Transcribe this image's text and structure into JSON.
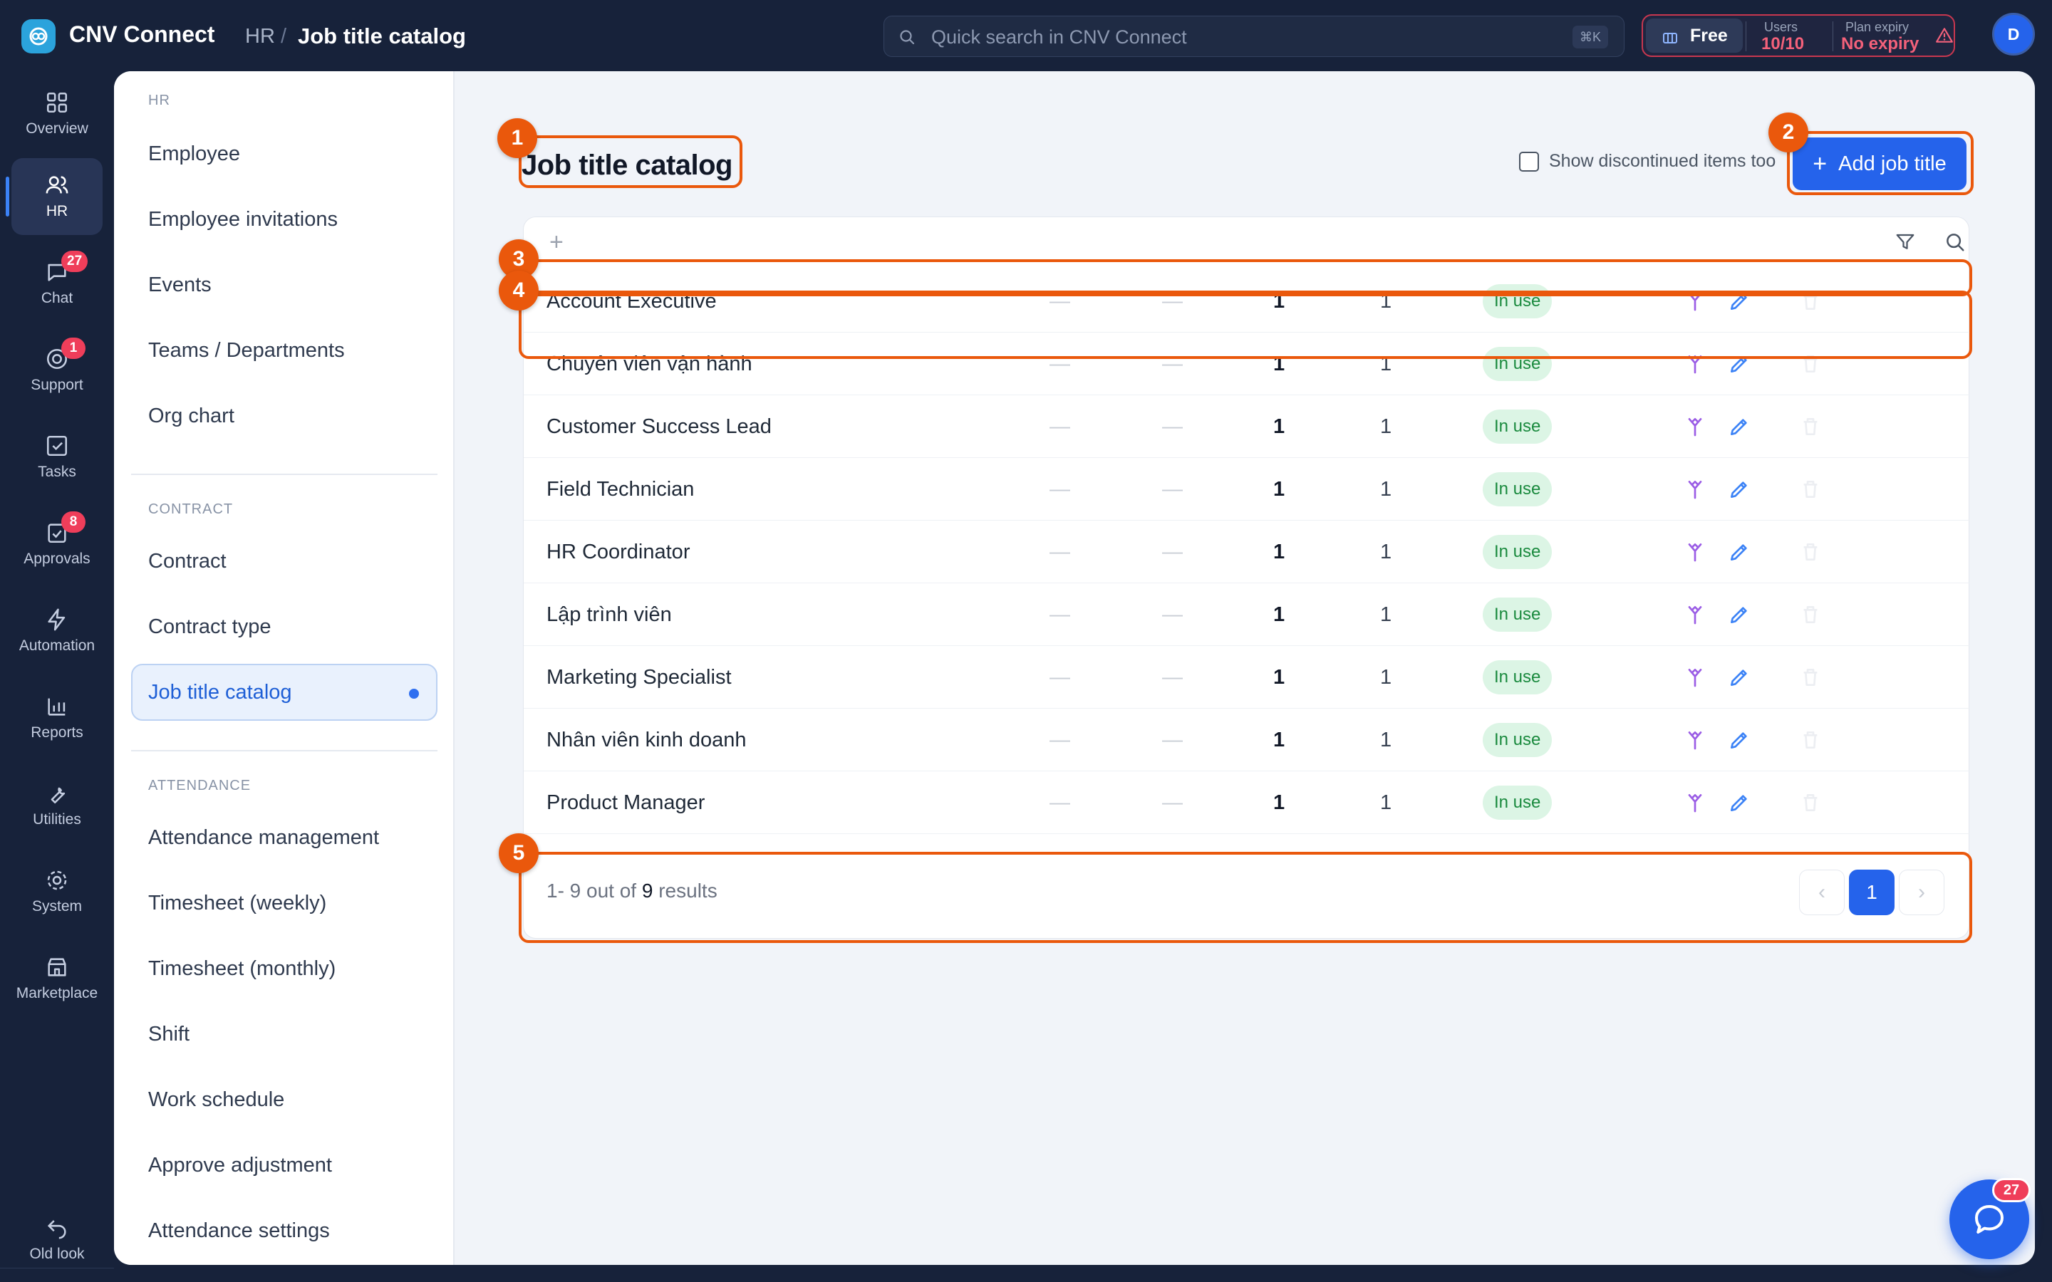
{
  "app": {
    "name": "CNV Connect"
  },
  "breadcrumb": {
    "section": "HR",
    "separator": "/",
    "current": "Job title catalog"
  },
  "search": {
    "placeholder": "Quick search in CNV Connect",
    "shortcut": "⌘K"
  },
  "plan": {
    "tier": "Free",
    "users_label": "Users",
    "users_value": "10/10",
    "expiry_label": "Plan expiry",
    "expiry_value": "No expiry"
  },
  "user": {
    "initial": "D"
  },
  "rail": [
    {
      "label": "Overview",
      "icon": "grid-icon"
    },
    {
      "label": "HR",
      "icon": "users-icon",
      "active": true
    },
    {
      "label": "Chat",
      "icon": "chat-icon",
      "badge": "27"
    },
    {
      "label": "Support",
      "icon": "support-icon",
      "badge": "1"
    },
    {
      "label": "Tasks",
      "icon": "check-square-icon"
    },
    {
      "label": "Approvals",
      "icon": "approval-icon",
      "badge": "8"
    },
    {
      "label": "Automation",
      "icon": "bolt-icon"
    },
    {
      "label": "Reports",
      "icon": "bar-chart-icon"
    },
    {
      "label": "Utilities",
      "icon": "wrench-icon"
    },
    {
      "label": "System",
      "icon": "gear-icon"
    },
    {
      "label": "Marketplace",
      "icon": "store-icon"
    }
  ],
  "rail_bottom": {
    "label": "Old look",
    "icon": "undo-icon"
  },
  "subnav": {
    "hr_title": "HR",
    "hr_items": [
      "Employee",
      "Employee invitations",
      "Events",
      "Teams / Departments",
      "Org chart"
    ],
    "contract_title": "CONTRACT",
    "contract_items": [
      "Contract",
      "Contract type",
      "Job title catalog"
    ],
    "attendance_title": "ATTENDANCE",
    "attendance_items": [
      "Attendance management",
      "Timesheet (weekly)",
      "Timesheet (monthly)",
      "Shift",
      "Work schedule",
      "Approve adjustment",
      "Attendance settings"
    ]
  },
  "page": {
    "title": "Job title catalog",
    "show_discontinued_label": "Show discontinued items too",
    "add_button": "Add job title",
    "add_button_plus": "+"
  },
  "toolbar": {
    "add": "+"
  },
  "table": {
    "rows": [
      {
        "name": "Account Executive",
        "d1": "—",
        "d2": "—",
        "n1": "1",
        "n2": "1",
        "status": "In use"
      },
      {
        "name": "Chuyên viên vận hành",
        "d1": "—",
        "d2": "—",
        "n1": "1",
        "n2": "1",
        "status": "In use"
      },
      {
        "name": "Customer Success Lead",
        "d1": "—",
        "d2": "—",
        "n1": "1",
        "n2": "1",
        "status": "In use"
      },
      {
        "name": "Field Technician",
        "d1": "—",
        "d2": "—",
        "n1": "1",
        "n2": "1",
        "status": "In use"
      },
      {
        "name": "HR Coordinator",
        "d1": "—",
        "d2": "—",
        "n1": "1",
        "n2": "1",
        "status": "In use"
      },
      {
        "name": "Lập trình viên",
        "d1": "—",
        "d2": "—",
        "n1": "1",
        "n2": "1",
        "status": "In use"
      },
      {
        "name": "Marketing Specialist",
        "d1": "—",
        "d2": "—",
        "n1": "1",
        "n2": "1",
        "status": "In use"
      },
      {
        "name": "Nhân viên kinh doanh",
        "d1": "—",
        "d2": "—",
        "n1": "1",
        "n2": "1",
        "status": "In use"
      },
      {
        "name": "Product Manager",
        "d1": "—",
        "d2": "—",
        "n1": "1",
        "n2": "1",
        "status": "In use"
      }
    ]
  },
  "pager": {
    "range": "1- 9 out of",
    "total": "9",
    "suffix": "results",
    "current_page": "1",
    "prev": "‹",
    "next": "›"
  },
  "markers": [
    "1",
    "2",
    "3",
    "4",
    "5"
  ],
  "chat_fab": {
    "badge": "27"
  },
  "colors": {
    "accent": "#2563eb",
    "highlight": "#ea580c",
    "status_green": "#1a8a3e",
    "rail_bg": "#17223a",
    "danger": "#ef3e5a"
  }
}
